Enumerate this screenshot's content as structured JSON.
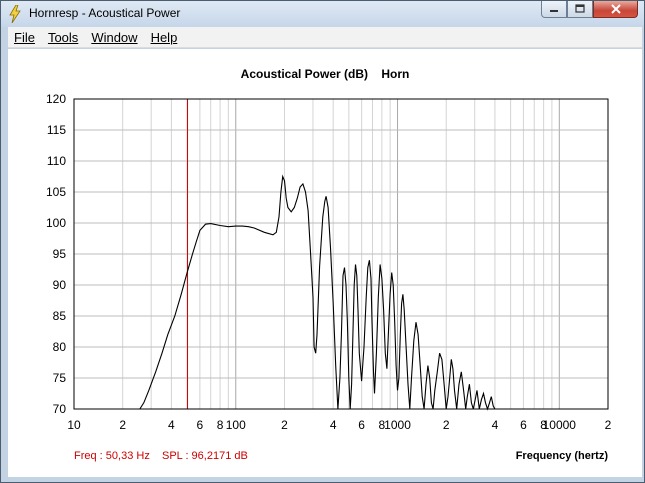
{
  "window": {
    "title": "Hornresp - Acoustical Power",
    "icon": "lightning-bolt-icon"
  },
  "menu": {
    "file": "File",
    "tools": "Tools",
    "window": "Window",
    "help": "Help"
  },
  "status": {
    "freq": "Freq : 50,33 Hz",
    "spl": "SPL : 96,2171 dB"
  },
  "chart_data": {
    "type": "line",
    "title": "Acoustical Power (dB)    Horn",
    "xlabel": "Frequency (hertz)",
    "ylabel": "",
    "xscale": "log",
    "xlim": [
      10,
      20000
    ],
    "ylim": [
      70,
      120
    ],
    "grid": true,
    "y_ticks": [
      "120",
      "115",
      "110",
      "105",
      "100",
      "95",
      "90",
      "85",
      "80",
      "75",
      "70"
    ],
    "x_ticks": [
      {
        "value": 10,
        "label": "10"
      },
      {
        "value": 20,
        "label": "2"
      },
      {
        "value": 40,
        "label": "4"
      },
      {
        "value": 60,
        "label": "6"
      },
      {
        "value": 80,
        "label": "8"
      },
      {
        "value": 100,
        "label": "100"
      },
      {
        "value": 200,
        "label": "2"
      },
      {
        "value": 400,
        "label": "4"
      },
      {
        "value": 600,
        "label": "6"
      },
      {
        "value": 800,
        "label": "8"
      },
      {
        "value": 1000,
        "label": "1000"
      },
      {
        "value": 2000,
        "label": "2"
      },
      {
        "value": 4000,
        "label": "4"
      },
      {
        "value": 6000,
        "label": "6"
      },
      {
        "value": 8000,
        "label": "8"
      },
      {
        "value": 10000,
        "label": "10000"
      },
      {
        "value": 20000,
        "label": "2"
      }
    ],
    "cursor_frequency": 50.33,
    "cursor_color": "#cc0000",
    "line_color": "#000000",
    "series": [
      {
        "x": [
          25.5,
          27,
          29,
          32,
          35,
          38,
          42,
          46,
          50,
          54,
          57,
          60,
          65,
          70,
          80,
          90,
          100,
          110,
          120,
          130,
          150,
          170,
          178,
          185,
          190,
          195,
          200,
          205,
          210,
          220,
          230,
          240,
          250,
          260,
          270,
          280,
          290,
          300,
          305,
          312,
          318,
          330,
          345,
          355,
          362,
          372,
          385,
          400,
          415,
          428,
          440,
          450,
          460,
          470,
          480,
          490,
          500,
          510,
          520,
          530,
          540,
          550,
          560,
          570,
          580,
          600,
          620,
          640,
          655,
          670,
          685,
          695,
          710,
          720,
          740,
          760,
          780,
          800,
          820,
          840,
          860,
          880,
          900,
          920,
          940,
          960,
          980,
          1000,
          1020,
          1040,
          1060,
          1080,
          1100,
          1130,
          1160,
          1190,
          1220,
          1260,
          1300,
          1340,
          1380,
          1420,
          1460,
          1500,
          1540,
          1580,
          1620,
          1660,
          1700,
          1760,
          1820,
          1880,
          1940,
          2000,
          2050,
          2100,
          2150,
          2200,
          2250,
          2320,
          2400,
          2480,
          2560,
          2640,
          2700,
          2780,
          2860,
          2940,
          3020,
          3100,
          3200,
          3300,
          3400,
          3500,
          3600,
          3700,
          3800,
          3900,
          4000
        ],
        "y": [
          70,
          71,
          73,
          76,
          79,
          82,
          85,
          88.5,
          92,
          95,
          97,
          98.8,
          99.8,
          99.9,
          99.6,
          99.4,
          99.5,
          99.5,
          99.4,
          99.2,
          98.5,
          98.1,
          98.5,
          101,
          105,
          107.5,
          106.8,
          104,
          102.5,
          101.8,
          102.5,
          104,
          105.8,
          106.3,
          105,
          102,
          95,
          88,
          80,
          79,
          82,
          93,
          101,
          103.5,
          104.3,
          102.5,
          96,
          87,
          77,
          70,
          75,
          82,
          91.5,
          92.8,
          90,
          84,
          75,
          70,
          74,
          82,
          90,
          93.3,
          91.5,
          86,
          79,
          74.5,
          80,
          88,
          92.8,
          94,
          91,
          84,
          76,
          72.5,
          79,
          88,
          93.3,
          91,
          86,
          79,
          76.5,
          83,
          88.5,
          92,
          90,
          84,
          77,
          73,
          75,
          82,
          87,
          88.5,
          86,
          80,
          74,
          70,
          75,
          81,
          84,
          82,
          77,
          72,
          70,
          74,
          77,
          75,
          71,
          70,
          73,
          76,
          79,
          78,
          74,
          70,
          72,
          75,
          78,
          76.5,
          73,
          70,
          74,
          76,
          73,
          70,
          72,
          74,
          71,
          70,
          71.5,
          73,
          70,
          71.5,
          72.5,
          71,
          70,
          71,
          72,
          70.5,
          70
        ]
      }
    ]
  }
}
